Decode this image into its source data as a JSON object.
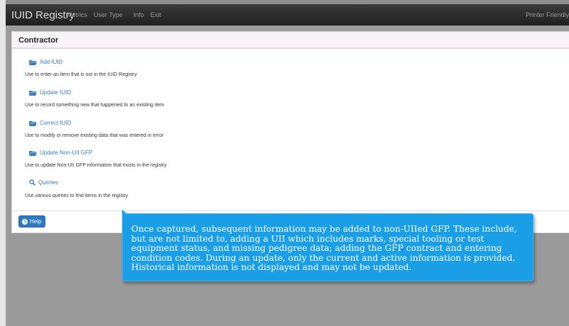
{
  "navbar": {
    "brand": "IUID Registry",
    "items": [
      "Metrics",
      "User Type",
      "Info",
      "Exit"
    ],
    "printer_friendly": "Printer Friendly"
  },
  "panel": {
    "title": "Contractor",
    "options": [
      {
        "label": "Add IUID",
        "icon": "folder-open-icon",
        "description": "Use to enter an item that is not in the IUID Registry"
      },
      {
        "label": "Update IUID",
        "icon": "folder-open-icon",
        "description": "Use to record something new that happened to an existing item"
      },
      {
        "label": "Correct IUID",
        "icon": "folder-open-icon",
        "description": "Use to modify or remove existing data that was entered in error"
      },
      {
        "label": "Update Non-UII GFP",
        "icon": "folder-open-icon",
        "description": "Use to update Non-UII GFP information that exists in the registry"
      },
      {
        "label": "Queries",
        "icon": "search-icon",
        "description": "Use various queries to find items in the registry"
      }
    ],
    "help_label": "Help"
  },
  "callout": {
    "text": "Once captured, subsequent information may be added to non-UIIed GFP. These include, but are not limited to, adding a UII which includes marks, special tooling or test equipment status, and missing pedigree data; adding the GFP contract and entering condition codes. During an update, only the current and active information is provided. Historical information is not displayed and may not be updated."
  },
  "colors": {
    "link": "#3a7ec2",
    "callout_bg": "#1a9ee6",
    "help_button": "#2f78c4",
    "navbar": "#2a2a2a"
  }
}
